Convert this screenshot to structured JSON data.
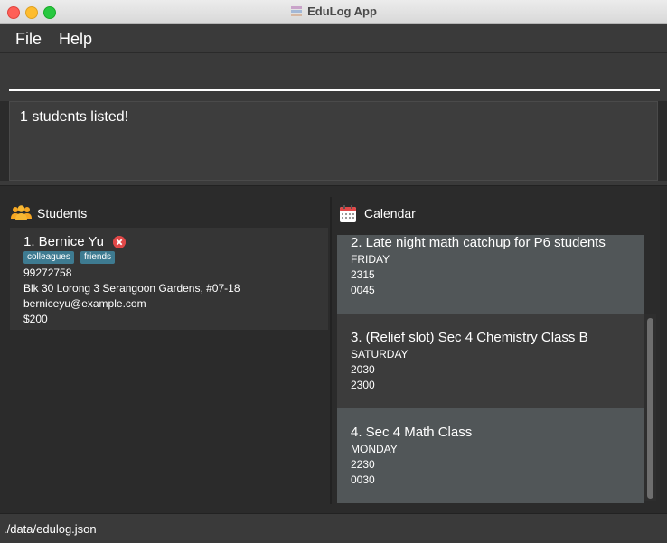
{
  "window": {
    "title": "EduLog App"
  },
  "menu": {
    "file": "File",
    "help": "Help"
  },
  "command": {
    "value": ""
  },
  "result": {
    "message": "1 students listed!"
  },
  "students_panel": {
    "title": "Students",
    "items": [
      {
        "name": "1. Bernice Yu",
        "tags": [
          "colleagues",
          "friends"
        ],
        "phone": "99272758",
        "address": "Blk 30 Lorong 3 Serangoon Gardens, #07-18",
        "email": "berniceyu@example.com",
        "fee": "$200"
      }
    ]
  },
  "calendar_panel": {
    "title": "Calendar",
    "items": [
      {
        "title": "2. Late night math catchup for P6 students",
        "day": "FRIDAY",
        "start": "2315",
        "end": "0045"
      },
      {
        "title": "3. (Relief slot) Sec 4 Chemistry Class B",
        "day": "SATURDAY",
        "start": "2030",
        "end": "2300"
      },
      {
        "title": "4. Sec 4 Math Class",
        "day": "MONDAY",
        "start": "2230",
        "end": "0030"
      }
    ]
  },
  "status": {
    "path": "./data/edulog.json"
  },
  "colors": {
    "accent": "#3e7b91",
    "delete": "#e04848",
    "background": "#2b2b2b"
  }
}
